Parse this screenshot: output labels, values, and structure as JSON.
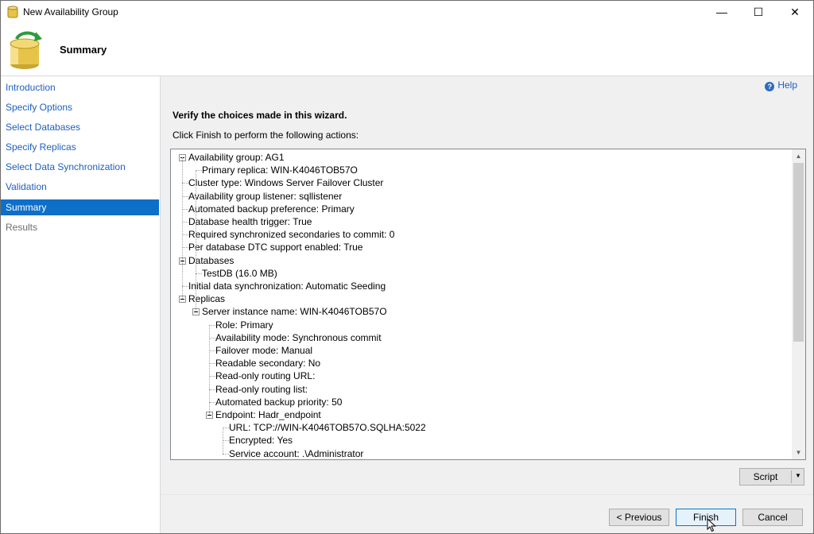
{
  "window": {
    "title": "New Availability Group",
    "minimize_glyph": "—",
    "maximize_glyph": "☐",
    "close_glyph": "✕"
  },
  "header": {
    "title": "Summary",
    "icon": "database-sync-icon"
  },
  "sidebar": {
    "items": [
      {
        "label": "Introduction",
        "state": "link"
      },
      {
        "label": "Specify Options",
        "state": "link"
      },
      {
        "label": "Select Databases",
        "state": "link"
      },
      {
        "label": "Specify Replicas",
        "state": "link"
      },
      {
        "label": "Select Data Synchronization",
        "state": "link"
      },
      {
        "label": "Validation",
        "state": "link"
      },
      {
        "label": "Summary",
        "state": "active"
      },
      {
        "label": "Results",
        "state": "disabled"
      }
    ]
  },
  "content": {
    "help_label": "Help",
    "help_icon": "?",
    "verify_text": "Verify the choices made in this wizard.",
    "instructions": "Click Finish to perform the following actions:",
    "tree": [
      {
        "text": "Availability group: AG1",
        "level": 0,
        "expandable": true
      },
      {
        "text": "Primary replica: WIN-K4046TOB57O",
        "level": 1,
        "expandable": false
      },
      {
        "text": "Cluster type: Windows Server Failover Cluster",
        "level": 0,
        "expandable": false
      },
      {
        "text": "Availability group listener: sqllistener",
        "level": 0,
        "expandable": false
      },
      {
        "text": "Automated backup preference: Primary",
        "level": 0,
        "expandable": false
      },
      {
        "text": "Database health trigger: True",
        "level": 0,
        "expandable": false
      },
      {
        "text": "Required synchronized secondaries to commit: 0",
        "level": 0,
        "expandable": false
      },
      {
        "text": "Per database DTC support enabled: True",
        "level": 0,
        "expandable": false
      },
      {
        "text": "Databases",
        "level": 0,
        "expandable": true
      },
      {
        "text": "TestDB (16.0 MB)",
        "level": 1,
        "expandable": false
      },
      {
        "text": "Initial data synchronization: Automatic Seeding",
        "level": 0,
        "expandable": false
      },
      {
        "text": "Replicas",
        "level": 0,
        "expandable": true
      },
      {
        "text": "Server instance name: WIN-K4046TOB57O",
        "level": 1,
        "expandable": true
      },
      {
        "text": "Role: Primary",
        "level": 2,
        "expandable": false
      },
      {
        "text": "Availability mode: Synchronous commit",
        "level": 2,
        "expandable": false
      },
      {
        "text": "Failover mode: Manual",
        "level": 2,
        "expandable": false
      },
      {
        "text": "Readable secondary: No",
        "level": 2,
        "expandable": false
      },
      {
        "text": "Read-only routing URL:",
        "level": 2,
        "expandable": false
      },
      {
        "text": "Read-only routing list:",
        "level": 2,
        "expandable": false
      },
      {
        "text": "Automated backup priority: 50",
        "level": 2,
        "expandable": false
      },
      {
        "text": "Endpoint: Hadr_endpoint",
        "level": 2,
        "expandable": true
      },
      {
        "text": "URL: TCP://WIN-K4046TOB57O.SQLHA:5022",
        "level": 3,
        "expandable": false
      },
      {
        "text": "Encrypted: Yes",
        "level": 3,
        "expandable": false
      },
      {
        "text": "Service account: .\\Administrator",
        "level": 3,
        "expandable": false
      }
    ],
    "script_label": "Script",
    "script_caret": "▼"
  },
  "footer": {
    "previous_label": "< Previous",
    "finish_label": "Finish",
    "cancel_label": "Cancel"
  },
  "colors": {
    "accent": "#0e6fc9",
    "link": "#1f5fbf",
    "panel_bg": "#f0f0f0"
  }
}
